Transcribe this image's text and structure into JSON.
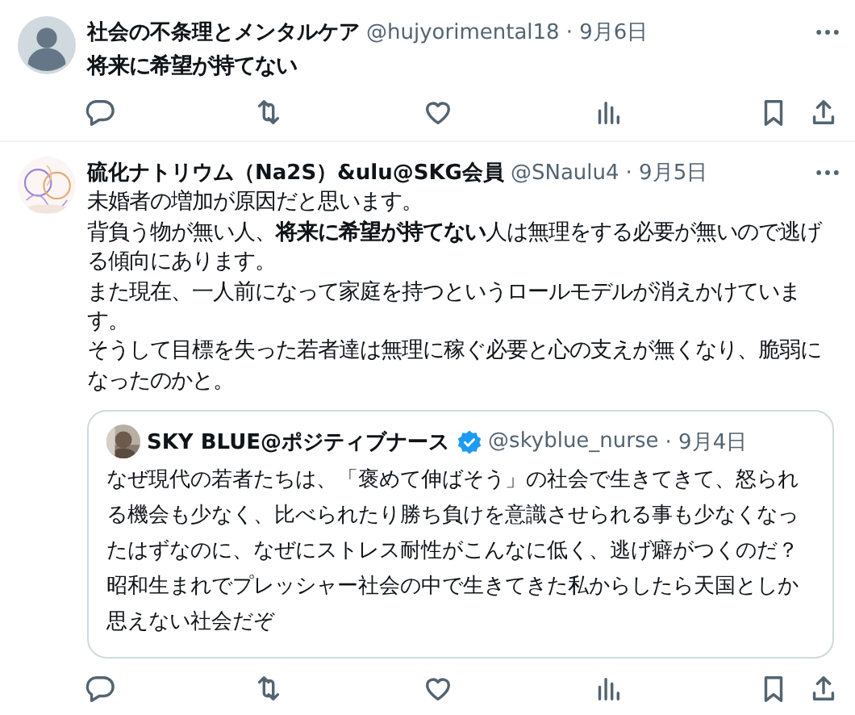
{
  "posts": [
    {
      "kind": "post",
      "avatar": {
        "kind": "default"
      },
      "name": "社会の不条理とメンタルケア",
      "handle": "@hujyorimental18",
      "date": "· 9月6日",
      "body": "将来に希望が持てない",
      "actions": [
        {
          "kind": "reply"
        },
        {
          "kind": "repost"
        },
        {
          "kind": "like"
        },
        {
          "kind": "views"
        },
        {
          "kind": "bookmark"
        },
        {
          "kind": "share"
        }
      ]
    },
    {
      "kind": "post",
      "name": "硫化ナトリウム（Na2S）&ulu@SKG会員",
      "handle": "@SNaulu4",
      "date": "· 9月5日",
      "body_lines": [
        "未婚者の増加が原因だと思います。",
        "背負う物が無い人、**将来に希望が持てない**人は無理をする必要が無いので逃げる傾向にあります。",
        "また現在、一人前になって家庭を持つというロールモデルが消えかけています。",
        "そうして目標を失った若者達は無理に稼ぐ必要と心の支えが無くなり、脆弱になったのかと。"
      ],
      "quote": {
        "name": "SKY BLUE@ポジティブナース",
        "verified": true,
        "handle": "@skyblue_nurse",
        "date": "· 9月4日",
        "body": "なぜ現代の若者たちは、「褒めて伸ばそう」の社会で生きてきて、怒られる機会も少なく、比べられたり勝ち負けを意識させられる事も少なくなったはずなのに、なぜにストレス耐性がこんなに低く、逃げ癖がつくのだ？昭和生まれでプレッシャー社会の中で生きてきた私からしたら天国としか思えない社会だぞ"
      },
      "actions": [
        {
          "kind": "reply"
        },
        {
          "kind": "repost"
        },
        {
          "kind": "like"
        },
        {
          "kind": "views"
        },
        {
          "kind": "bookmark"
        },
        {
          "kind": "share"
        }
      ]
    }
  ]
}
